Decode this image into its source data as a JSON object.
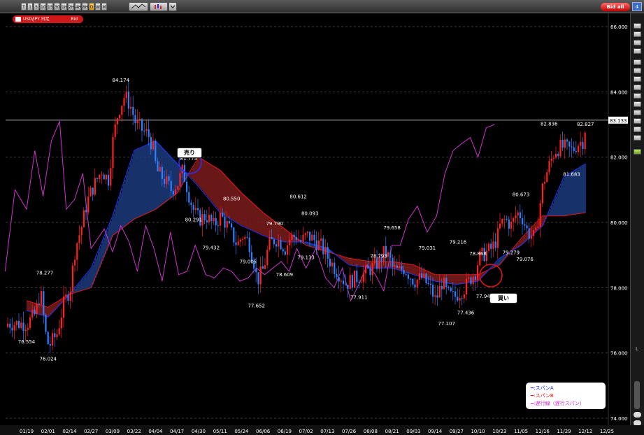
{
  "toolbar": {
    "timeframes": [
      "T",
      "1",
      "5",
      "10",
      "15",
      "30",
      "1H",
      "2H",
      "4H",
      "8H",
      "D",
      "W",
      "M"
    ],
    "active_timeframe": "D",
    "bid_all_label": "Bid all",
    "right_badge": "4"
  },
  "symbol_tab": {
    "label": "USD/JPY 日足",
    "side": "Bid"
  },
  "annotations": {
    "sell_label": "売り",
    "buy_label": "買い"
  },
  "legend": [
    {
      "text": "━:スパンA",
      "color": "#2233ff"
    },
    {
      "text": "━:スパンB",
      "color": "#ee1111"
    },
    {
      "text": "━:遅行線（遅行スパン）",
      "color": "#cc22cc"
    }
  ],
  "colors": {
    "up": "#ff2020",
    "down": "#2f7fff",
    "spanA": "#2233ff",
    "spanB": "#e01818",
    "chikou": "#cc33cc",
    "cloud_bull": "#1b3a7a",
    "cloud_bear": "#7a1b1b"
  },
  "chart_data": {
    "type": "candlestick",
    "instrument": "USD/JPY",
    "timeframe": "daily",
    "current_price_label": "83.133",
    "ylim": [
      74.0,
      87.0
    ],
    "y_ticks": [
      "86.000",
      "84.000",
      "82.000",
      "80.000",
      "78.000",
      "76.000",
      "74.000"
    ],
    "x_ticks": [
      "01/19",
      "02/01",
      "02/14",
      "02/27",
      "03/09",
      "03/22",
      "04/04",
      "04/17",
      "04/30",
      "05/11",
      "05/24",
      "06/06",
      "06/19",
      "07/02",
      "07/13",
      "07/26",
      "08/08",
      "08/21",
      "09/03",
      "09/14",
      "09/27",
      "10/10",
      "10/23",
      "11/05",
      "11/16",
      "11/29",
      "12/12",
      "12/25"
    ],
    "price_labels": [
      {
        "text": "76.554",
        "pos": "low"
      },
      {
        "text": "78.277",
        "pos": "high"
      },
      {
        "text": "76.024",
        "pos": "low"
      },
      {
        "text": "84.174",
        "pos": "high"
      },
      {
        "text": "81.775",
        "pos": "high"
      },
      {
        "text": "80.291",
        "pos": "low"
      },
      {
        "text": "80.550",
        "pos": "high"
      },
      {
        "text": "79.432",
        "pos": "low"
      },
      {
        "text": "79.005",
        "pos": "low"
      },
      {
        "text": "79.790",
        "pos": "high"
      },
      {
        "text": "77.652",
        "pos": "low"
      },
      {
        "text": "78.609",
        "pos": "low"
      },
      {
        "text": "80.612",
        "pos": "high"
      },
      {
        "text": "80.093",
        "pos": "high"
      },
      {
        "text": "79.133",
        "pos": "low"
      },
      {
        "text": "77.911",
        "pos": "low"
      },
      {
        "text": "78.793",
        "pos": "high"
      },
      {
        "text": "79.658",
        "pos": "high"
      },
      {
        "text": "79.031",
        "pos": "high"
      },
      {
        "text": "77.107",
        "pos": "low"
      },
      {
        "text": "79.216",
        "pos": "high"
      },
      {
        "text": "77.436",
        "pos": "low"
      },
      {
        "text": "78.868",
        "pos": "high"
      },
      {
        "text": "77.947",
        "pos": "low"
      },
      {
        "text": "80.673",
        "pos": "high"
      },
      {
        "text": "79.279",
        "pos": "low"
      },
      {
        "text": "79.076",
        "pos": "low"
      },
      {
        "text": "82.836",
        "pos": "high"
      },
      {
        "text": "82.827",
        "pos": "high"
      },
      {
        "text": "81.683",
        "pos": "low"
      }
    ],
    "close_path": [
      [
        "01/19",
        76.9
      ],
      [
        "01/24",
        77.2
      ],
      [
        "01/27",
        77.9
      ],
      [
        "01/30",
        76.6
      ],
      [
        "02/01",
        76.2
      ],
      [
        "02/06",
        76.6
      ],
      [
        "02/10",
        77.5
      ],
      [
        "02/14",
        78.0
      ],
      [
        "02/17",
        79.2
      ],
      [
        "02/21",
        79.9
      ],
      [
        "02/24",
        80.6
      ],
      [
        "02/27",
        81.0
      ],
      [
        "03/02",
        81.6
      ],
      [
        "03/06",
        81.3
      ],
      [
        "03/09",
        82.6
      ],
      [
        "03/12",
        83.4
      ],
      [
        "03/16",
        83.9
      ],
      [
        "03/20",
        83.5
      ],
      [
        "03/22",
        83.1
      ],
      [
        "03/27",
        82.8
      ],
      [
        "03/30",
        82.7
      ],
      [
        "04/02",
        82.3
      ],
      [
        "04/04",
        81.6
      ],
      [
        "04/09",
        81.3
      ],
      [
        "04/13",
        81.0
      ],
      [
        "04/17",
        81.2
      ],
      [
        "04/20",
        81.6
      ],
      [
        "04/24",
        80.8
      ],
      [
        "04/27",
        80.3
      ],
      [
        "04/30",
        80.1
      ],
      [
        "05/03",
        80.2
      ],
      [
        "05/07",
        79.9
      ],
      [
        "05/11",
        80.2
      ],
      [
        "05/15",
        79.9
      ],
      [
        "05/18",
        79.6
      ],
      [
        "05/21",
        79.3
      ],
      [
        "05/24",
        79.6
      ],
      [
        "05/28",
        79.4
      ],
      [
        "05/31",
        78.8
      ],
      [
        "06/02",
        78.2
      ],
      [
        "06/06",
        78.6
      ],
      [
        "06/09",
        79.3
      ],
      [
        "06/13",
        79.5
      ],
      [
        "06/16",
        79.4
      ],
      [
        "06/19",
        79.2
      ],
      [
        "06/22",
        79.5
      ],
      [
        "06/26",
        79.6
      ],
      [
        "06/29",
        79.4
      ],
      [
        "07/02",
        79.6
      ],
      [
        "07/05",
        79.5
      ],
      [
        "07/09",
        79.3
      ],
      [
        "07/13",
        78.9
      ],
      [
        "07/17",
        78.6
      ],
      [
        "07/20",
        78.4
      ],
      [
        "07/24",
        78.1
      ],
      [
        "07/26",
        78.2
      ],
      [
        "07/30",
        78.3
      ],
      [
        "08/03",
        78.4
      ],
      [
        "08/06",
        78.5
      ],
      [
        "08/08",
        78.6
      ],
      [
        "08/13",
        78.8
      ],
      [
        "08/16",
        79.1
      ],
      [
        "08/19",
        78.9
      ],
      [
        "08/21",
        78.6
      ],
      [
        "08/24",
        78.5
      ],
      [
        "08/28",
        78.6
      ],
      [
        "08/31",
        78.4
      ],
      [
        "09/03",
        78.2
      ],
      [
        "09/07",
        78.3
      ],
      [
        "09/11",
        78.0
      ],
      [
        "09/14",
        77.6
      ],
      [
        "09/18",
        78.2
      ],
      [
        "09/21",
        77.8
      ],
      [
        "09/25",
        77.7
      ],
      [
        "09/27",
        77.8
      ],
      [
        "10/01",
        78.0
      ],
      [
        "10/05",
        78.3
      ],
      [
        "10/08",
        78.5
      ],
      [
        "10/10",
        78.9
      ],
      [
        "10/15",
        79.1
      ],
      [
        "10/18",
        79.2
      ],
      [
        "10/21",
        79.5
      ],
      [
        "10/23",
        79.9
      ],
      [
        "10/26",
        80.1
      ],
      [
        "10/30",
        79.9
      ],
      [
        "11/02",
        80.3
      ],
      [
        "11/05",
        80.2
      ],
      [
        "11/08",
        79.7
      ],
      [
        "11/12",
        79.5
      ],
      [
        "11/14",
        80.4
      ],
      [
        "11/16",
        81.2
      ],
      [
        "11/20",
        81.8
      ],
      [
        "11/23",
        82.2
      ],
      [
        "11/26",
        82.3
      ],
      [
        "11/29",
        82.3
      ],
      [
        "12/03",
        82.2
      ],
      [
        "12/06",
        82.4
      ],
      [
        "12/10",
        82.5
      ],
      [
        "12/12",
        83.1
      ]
    ],
    "spanA_path": [
      [
        "01/19",
        77.3
      ],
      [
        "02/01",
        77.1
      ],
      [
        "02/14",
        77.8
      ],
      [
        "02/27",
        78.6
      ],
      [
        "03/09",
        80.2
      ],
      [
        "03/22",
        82.2
      ],
      [
        "04/04",
        82.5
      ],
      [
        "04/17",
        81.8
      ],
      [
        "04/30",
        81.1
      ],
      [
        "05/11",
        80.3
      ],
      [
        "05/24",
        79.9
      ],
      [
        "06/06",
        79.6
      ],
      [
        "06/19",
        79.4
      ],
      [
        "07/02",
        79.4
      ],
      [
        "07/13",
        79.2
      ],
      [
        "07/26",
        78.7
      ],
      [
        "08/08",
        78.6
      ],
      [
        "08/21",
        78.6
      ],
      [
        "09/03",
        78.4
      ],
      [
        "09/14",
        78.2
      ],
      [
        "09/27",
        78.1
      ],
      [
        "10/10",
        78.2
      ],
      [
        "10/23",
        78.9
      ],
      [
        "11/05",
        79.3
      ],
      [
        "11/16",
        79.9
      ],
      [
        "11/29",
        81.4
      ],
      [
        "12/12",
        81.8
      ]
    ],
    "spanB_path": [
      [
        "01/19",
        77.6
      ],
      [
        "02/01",
        77.4
      ],
      [
        "02/14",
        77.8
      ],
      [
        "02/27",
        78.0
      ],
      [
        "03/09",
        79.6
      ],
      [
        "03/22",
        80.1
      ],
      [
        "04/04",
        80.4
      ],
      [
        "04/17",
        80.9
      ],
      [
        "04/30",
        82.0
      ],
      [
        "05/11",
        81.6
      ],
      [
        "05/24",
        80.9
      ],
      [
        "06/06",
        80.3
      ],
      [
        "06/19",
        79.8
      ],
      [
        "07/02",
        79.3
      ],
      [
        "07/13",
        79.1
      ],
      [
        "07/26",
        78.9
      ],
      [
        "08/08",
        78.8
      ],
      [
        "08/21",
        78.8
      ],
      [
        "09/03",
        78.7
      ],
      [
        "09/14",
        78.4
      ],
      [
        "09/27",
        78.4
      ],
      [
        "10/10",
        78.4
      ],
      [
        "10/23",
        78.7
      ],
      [
        "11/05",
        79.5
      ],
      [
        "11/16",
        80.2
      ],
      [
        "11/29",
        80.2
      ],
      [
        "12/12",
        80.3
      ]
    ],
    "chikou_path": [
      [
        "01/06",
        78.5
      ],
      [
        "01/12",
        81.0
      ],
      [
        "01/19",
        80.4
      ],
      [
        "01/24",
        82.2
      ],
      [
        "01/29",
        80.8
      ],
      [
        "02/03",
        82.5
      ],
      [
        "02/08",
        83.1
      ],
      [
        "02/12",
        80.4
      ],
      [
        "02/17",
        80.7
      ],
      [
        "02/22",
        81.5
      ],
      [
        "02/27",
        79.2
      ],
      [
        "03/04",
        79.8
      ],
      [
        "03/09",
        79.1
      ],
      [
        "03/14",
        79.9
      ],
      [
        "03/19",
        79.4
      ],
      [
        "03/24",
        78.5
      ],
      [
        "03/29",
        79.9
      ],
      [
        "04/03",
        79.2
      ],
      [
        "04/08",
        78.2
      ],
      [
        "04/13",
        79.7
      ],
      [
        "04/18",
        78.4
      ],
      [
        "04/23",
        78.5
      ],
      [
        "04/28",
        79.3
      ],
      [
        "05/03",
        78.4
      ],
      [
        "05/08",
        78.3
      ],
      [
        "05/13",
        78.6
      ],
      [
        "05/18",
        78.5
      ],
      [
        "05/23",
        78.2
      ],
      [
        "05/28",
        78.3
      ],
      [
        "06/02",
        78.6
      ],
      [
        "06/07",
        78.4
      ],
      [
        "06/12",
        78.6
      ],
      [
        "06/17",
        78.8
      ],
      [
        "06/22",
        78.5
      ],
      [
        "06/27",
        79.2
      ],
      [
        "07/02",
        78.6
      ],
      [
        "07/07",
        79.2
      ],
      [
        "07/12",
        78.3
      ],
      [
        "07/17",
        78.0
      ],
      [
        "07/22",
        78.6
      ],
      [
        "07/27",
        77.6
      ],
      [
        "08/01",
        78.1
      ],
      [
        "08/06",
        78.7
      ],
      [
        "08/11",
        78.4
      ],
      [
        "08/16",
        77.9
      ],
      [
        "08/21",
        79.3
      ],
      [
        "08/26",
        79.3
      ],
      [
        "08/31",
        80.1
      ],
      [
        "09/05",
        80.5
      ],
      [
        "09/10",
        79.7
      ],
      [
        "09/15",
        80.2
      ],
      [
        "09/20",
        81.5
      ],
      [
        "09/25",
        82.2
      ],
      [
        "09/30",
        82.4
      ],
      [
        "10/05",
        82.6
      ],
      [
        "10/10",
        82.0
      ],
      [
        "10/15",
        82.9
      ],
      [
        "10/20",
        83.0
      ]
    ]
  }
}
